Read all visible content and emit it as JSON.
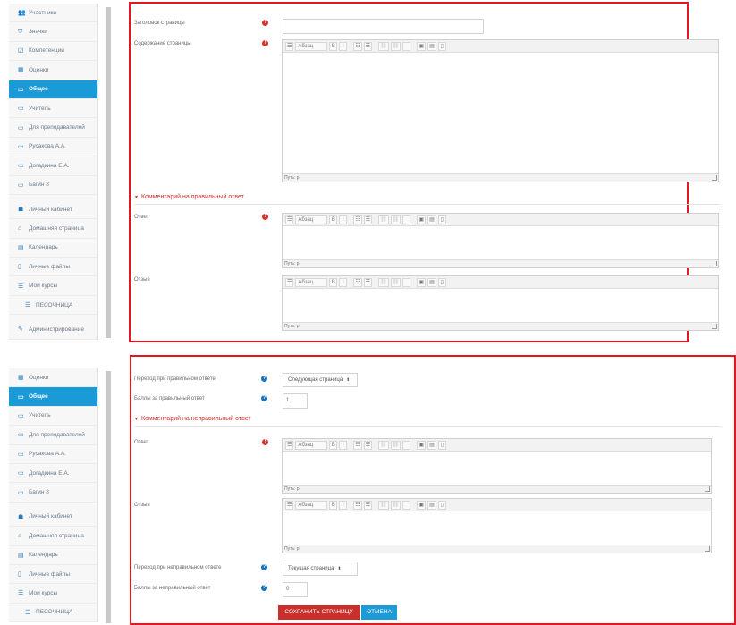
{
  "panel1": {
    "sidebar": [
      {
        "icon": "👥",
        "label": "Участники",
        "active": false
      },
      {
        "icon": "⛉",
        "label": "Значки",
        "active": false
      },
      {
        "icon": "☑",
        "label": "Компетенции",
        "active": false
      },
      {
        "icon": "▦",
        "label": "Оценки",
        "active": false
      },
      {
        "icon": "▭",
        "label": "Общее",
        "active": true
      },
      {
        "icon": "▭",
        "label": "Учитель",
        "active": false
      },
      {
        "icon": "▭",
        "label": "Для преподавателей",
        "active": false
      },
      {
        "icon": "▭",
        "label": "Русакова А.А.",
        "active": false
      },
      {
        "icon": "▭",
        "label": "Догадкина Е.А.",
        "active": false
      },
      {
        "icon": "▭",
        "label": "Багин 8",
        "active": false
      },
      {
        "icon": "☗",
        "label": "Личный кабинет",
        "active": false
      },
      {
        "icon": "⌂",
        "label": "Домашняя страница",
        "active": false
      },
      {
        "icon": "▤",
        "label": "Календарь",
        "active": false
      },
      {
        "icon": "▯",
        "label": "Личные файлы",
        "active": false
      },
      {
        "icon": "☰",
        "label": "Мои курсы",
        "active": false
      },
      {
        "icon": "☰",
        "label": "ПЕСОЧНИЦА",
        "active": false
      },
      {
        "icon": "✎",
        "label": "Администрирование",
        "active": false
      }
    ],
    "page_title_label": "Заголовок страницы",
    "page_content_label": "Содержание страницы",
    "section_correct": "Комментарий на правильный ответ",
    "answer_label": "Ответ",
    "feedback_label": "Отзыв"
  },
  "panel2": {
    "sidebar": [
      {
        "icon": "▦",
        "label": "Оценки",
        "active": false
      },
      {
        "icon": "▭",
        "label": "Общее",
        "active": true
      },
      {
        "icon": "▭",
        "label": "Учитель",
        "active": false
      },
      {
        "icon": "▭",
        "label": "Для преподавателей",
        "active": false
      },
      {
        "icon": "▭",
        "label": "Русакова А.А.",
        "active": false
      },
      {
        "icon": "▭",
        "label": "Догадкина Е.А.",
        "active": false
      },
      {
        "icon": "▭",
        "label": "Багин 8",
        "active": false
      },
      {
        "icon": "☗",
        "label": "Личный кабинет",
        "active": false
      },
      {
        "icon": "⌂",
        "label": "Домашняя страница",
        "active": false
      },
      {
        "icon": "▤",
        "label": "Календарь",
        "active": false
      },
      {
        "icon": "▯",
        "label": "Личные файлы",
        "active": false
      },
      {
        "icon": "☰",
        "label": "Мои курсы",
        "active": false
      },
      {
        "icon": "☰",
        "label": "ПЕСОЧНИЦА",
        "active": false
      }
    ],
    "jump_correct_label": "Переход при правильном ответе",
    "jump_correct_value": "Следующая страница",
    "score_correct_label": "Баллы за правильный ответ",
    "score_correct_value": "1",
    "section_wrong": "Комментарий на неправильный ответ",
    "answer_label": "Ответ",
    "feedback_label": "Отзыв",
    "jump_wrong_label": "Переход при неправильном ответе",
    "jump_wrong_value": "Текущая страница",
    "score_wrong_label": "Баллы за неправильный ответ",
    "score_wrong_value": "0",
    "save_button": "СОХРАНИТЬ СТРАНИЦУ",
    "cancel_button": "ОТМЕНА"
  },
  "editor": {
    "format_label": "Абзац",
    "bold": "B",
    "italic": "I",
    "path_label": "Путь: p"
  },
  "colors": {
    "frame_red": "#e5161f",
    "sidebar_active": "#1a9ad7",
    "required_icon": "#d0352f",
    "info_icon": "#1a73b9",
    "save_button": "#c9302c",
    "cancel_button": "#1f9ad6"
  }
}
